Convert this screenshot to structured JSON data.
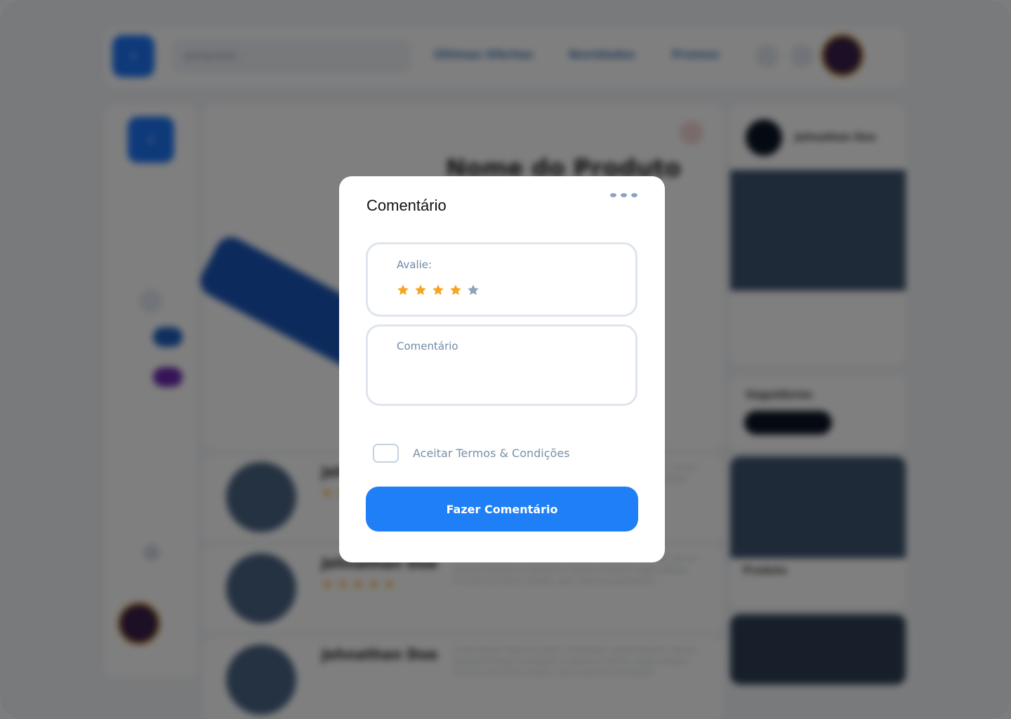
{
  "background": {
    "search_placeholder": "pesquisar...",
    "nav": [
      "Últimas Ofertas",
      "Novidades",
      "Promos"
    ],
    "product_title": "Nome do Produto",
    "reviewer_name": "Jehnathan Doe",
    "review_text": "Lorem ipsum dolor sit amet, consectetur adipiscing elit, sed do eiusmod tempor incididunt ut labore et dolore magna aliqua. Ut enim ad minim veniam, quis nostrud exercitation.",
    "followers_title": "Seguidores",
    "product_label": "Produto"
  },
  "modal": {
    "title": "Comentário",
    "rating_label": "Avalie:",
    "rating_value": 4,
    "rating_max": 5,
    "comment_label": "Comentário",
    "terms_label": "Aceitar Termos & Condições",
    "terms_checked": false,
    "submit_label": "Fazer Comentário"
  },
  "colors": {
    "primary": "#1f7ff6",
    "star_filled": "#f5a623",
    "star_empty": "#8da4bd",
    "overlay": "rgba(0,0,0,0.5)"
  },
  "icons": {
    "more": "more-dots-icon",
    "star": "star-icon"
  }
}
